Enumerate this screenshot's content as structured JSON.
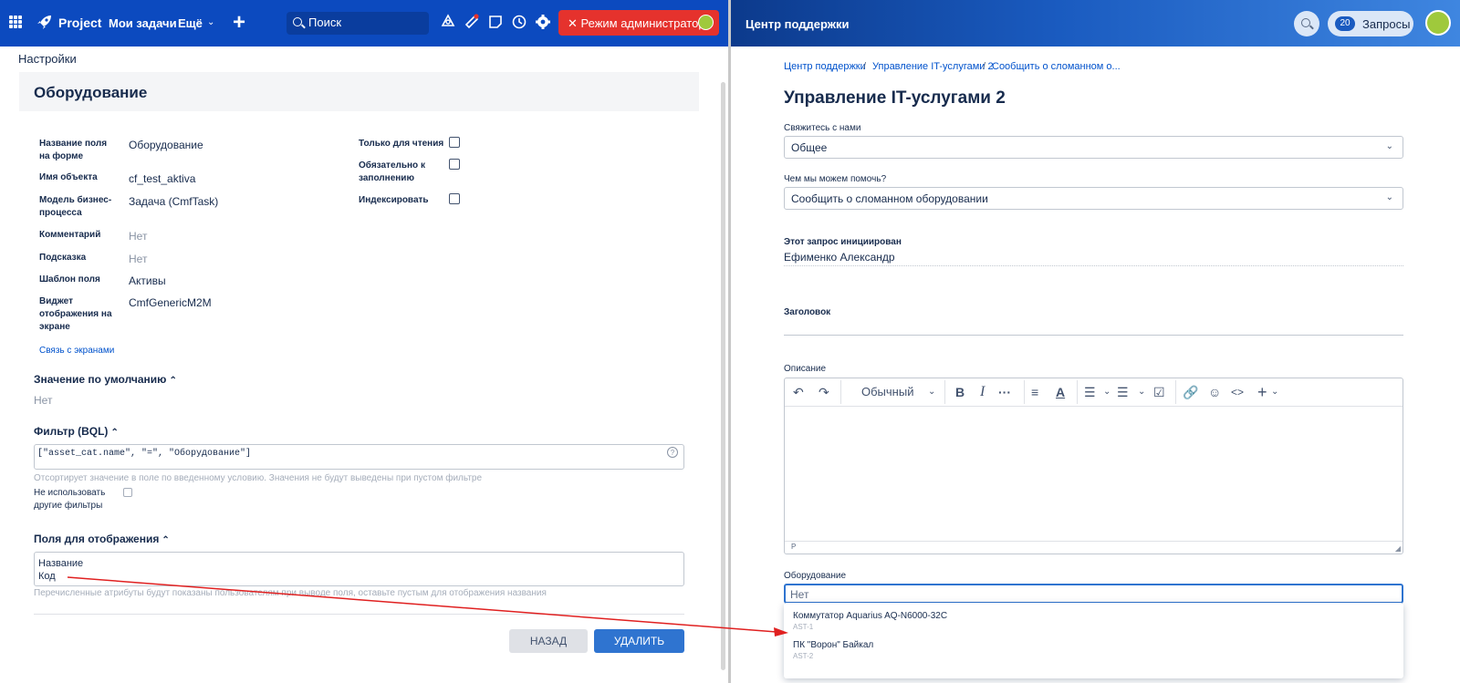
{
  "left": {
    "nav": {
      "brand": "Project",
      "my_tasks": "Мои задачи",
      "more": "Ещё",
      "search_placeholder": "Поиск",
      "admin_mode": "Режим администратора"
    },
    "breadcrumb": "Настройки",
    "panel_title": "Оборудование",
    "fields": {
      "form_name_label": "Название поля на форме",
      "form_name_value": "Оборудование",
      "object_name_label": "Имя объекта",
      "object_name_value": "cf_test_aktiva",
      "model_label": "Модель бизнес-процесса",
      "model_value": "Задача (CmfTask)",
      "comment_label": "Комментарий",
      "comment_value": "Нет",
      "hint_label": "Подсказка",
      "hint_value": "Нет",
      "template_label": "Шаблон поля",
      "template_value": "Активы",
      "widget_label": "Виджет отображения на экране",
      "widget_value": "CmfGenericM2M",
      "readonly_label": "Только для чтения",
      "required_label": "Обязательно к заполнению",
      "index_label": "Индексировать",
      "screens_link": "Связь с экранами"
    },
    "default_section": {
      "title": "Значение по умолчанию",
      "value": "Нет"
    },
    "filter_section": {
      "title": "Фильтр (BQL)",
      "query": "[\"asset_cat.name\", \"=\", \"Оборудование\"]",
      "hint": "Отсортирует значение в поле по введенному условию. Значения не будут выведены при пустом фильтре",
      "no_other_filters_label": "Не использовать другие фильтры"
    },
    "display_section": {
      "title": "Поля для отображения",
      "line1": "Название",
      "line2": "Код",
      "hint": "Перечисленные атрибуты будут показаны пользователям при выводе поля, оставьте пустым для отображения названия"
    },
    "buttons": {
      "back": "НАЗАД",
      "delete": "УДАЛИТЬ"
    }
  },
  "right": {
    "header_title": "Центр поддержки",
    "requests_count": "20",
    "requests_label": "Запросы",
    "breadcrumbs": [
      "Центр поддержки",
      "Управление IT-услугами 2",
      "Сообщить о сломанном о..."
    ],
    "page_title": "Управление IT-услугами 2",
    "contact_label": "Свяжитесь с нами",
    "contact_value": "Общее",
    "help_label": "Чем мы можем помочь?",
    "help_value": "Сообщить о сломанном оборудовании",
    "initiator_label": "Этот запрос инициирован",
    "initiator_value": "Ефименко Александр",
    "summary_label": "Заголовок",
    "description_label": "Описание",
    "editor_style": "Обычный",
    "editor_path": "P",
    "equipment_label": "Оборудование",
    "equipment_value": "Нет",
    "options": [
      {
        "name": "Коммутатор Aquarius AQ-N6000-32C",
        "code": "AST-1"
      },
      {
        "name": "ПК \"Ворон\" Байкал",
        "code": "AST-2"
      }
    ]
  },
  "colors": {
    "nav_blue": "#0c4abf",
    "admin_red": "#e5322d",
    "primary_button": "#2f74d0",
    "annotation_arrow": "#e02020"
  }
}
